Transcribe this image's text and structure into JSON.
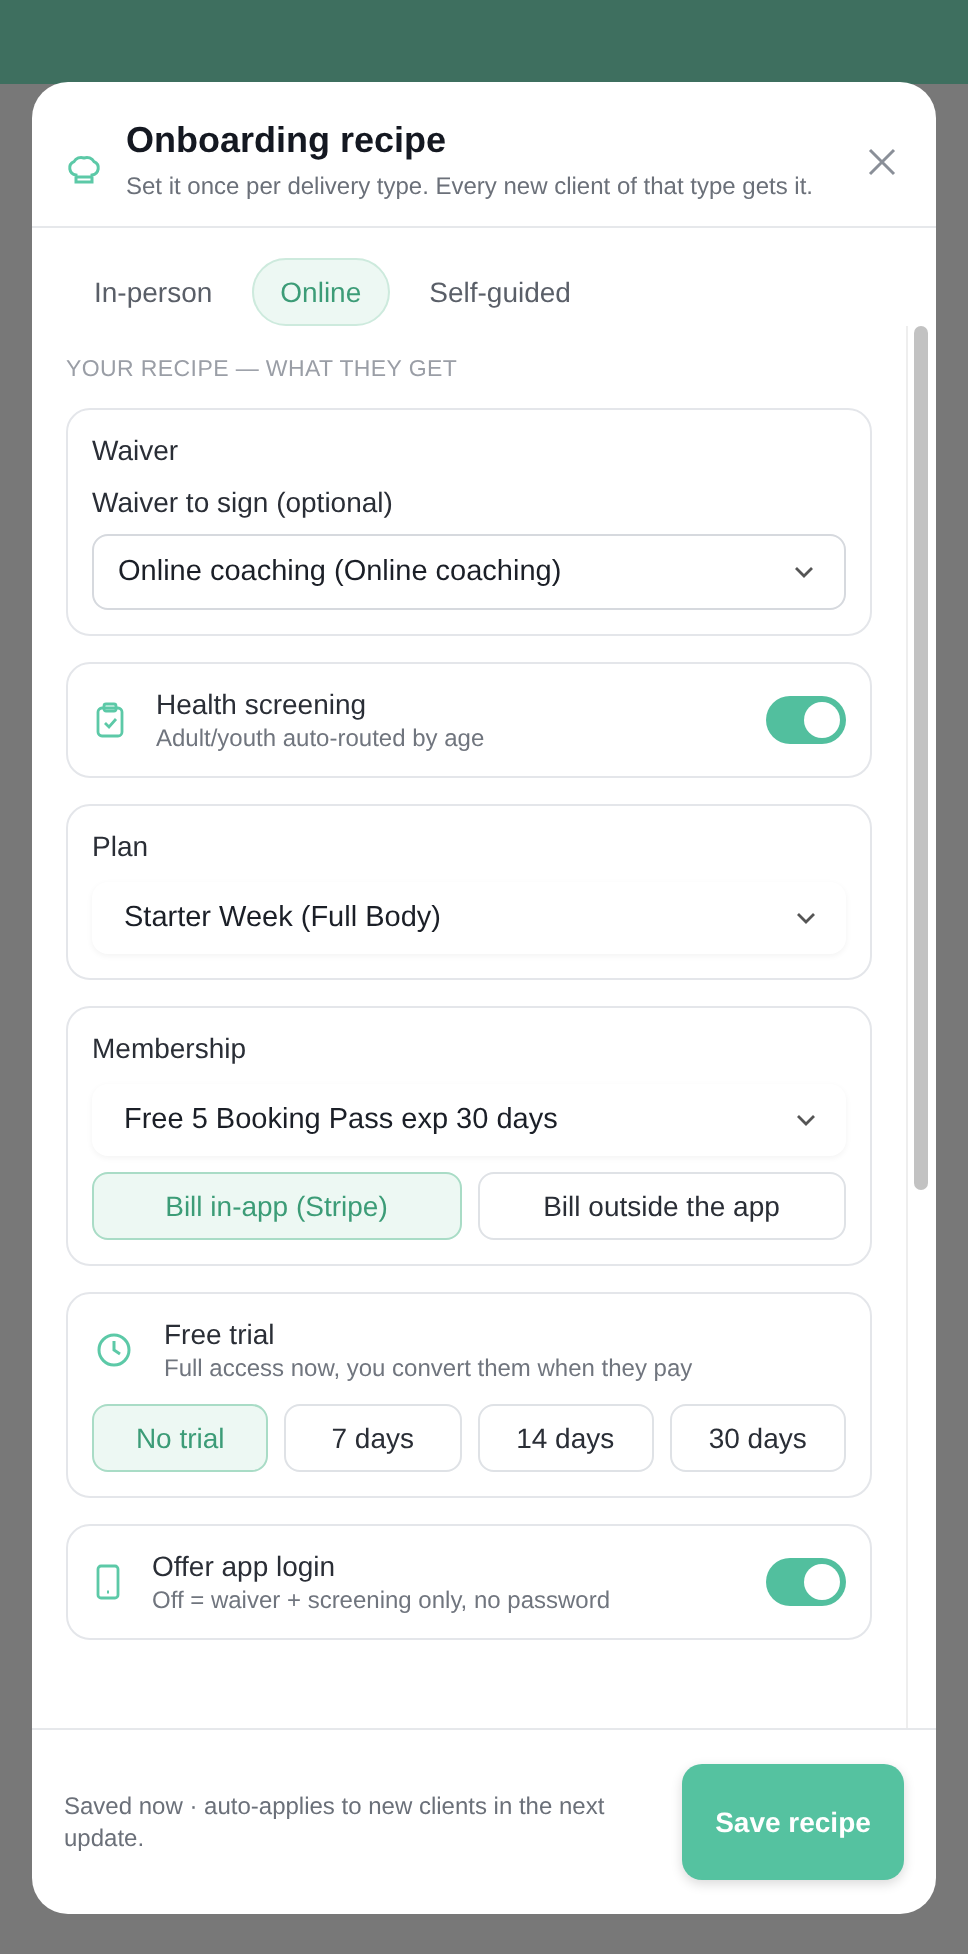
{
  "dialog": {
    "title": "Onboarding recipe",
    "subtitle": "Set it once per delivery type. Every new client of that type gets it."
  },
  "tabs": [
    {
      "label": "In-person",
      "selected": false
    },
    {
      "label": "Online",
      "selected": true
    },
    {
      "label": "Self-guided",
      "selected": false
    }
  ],
  "section_label": "YOUR RECIPE — WHAT THEY GET",
  "cards": [
    {
      "kind": "select",
      "title": "Waiver",
      "field_label": "Waiver to sign (optional)",
      "value": "Online coaching (Online coaching)"
    },
    {
      "kind": "toggle",
      "title": "Health screening",
      "subtitle": "Adult/youth auto-routed by age",
      "on": true
    },
    {
      "kind": "select",
      "title": "Plan",
      "value": "Starter Week (Full Body)"
    },
    {
      "kind": "select",
      "title": "Membership",
      "value": "Free 5 Booking Pass exp 30 days",
      "options": [
        {
          "label": "Bill in-app (Stripe)",
          "selected": true
        },
        {
          "label": "Bill outside the app",
          "selected": false
        }
      ]
    },
    {
      "kind": "choices",
      "title": "Free trial",
      "subtitle": "Full access now, you convert them when they pay",
      "options": [
        {
          "label": "No trial",
          "selected": true
        },
        {
          "label": "7 days",
          "selected": false
        },
        {
          "label": "14 days",
          "selected": false
        },
        {
          "label": "30 days",
          "selected": false
        }
      ]
    },
    {
      "kind": "toggle",
      "title": "Offer app login",
      "subtitle": "Off = waiver + screening only, no password",
      "on": true
    }
  ],
  "footer": {
    "note": "Saved now · auto-applies to new clients in the next update.",
    "save_button": "Save recipe"
  }
}
